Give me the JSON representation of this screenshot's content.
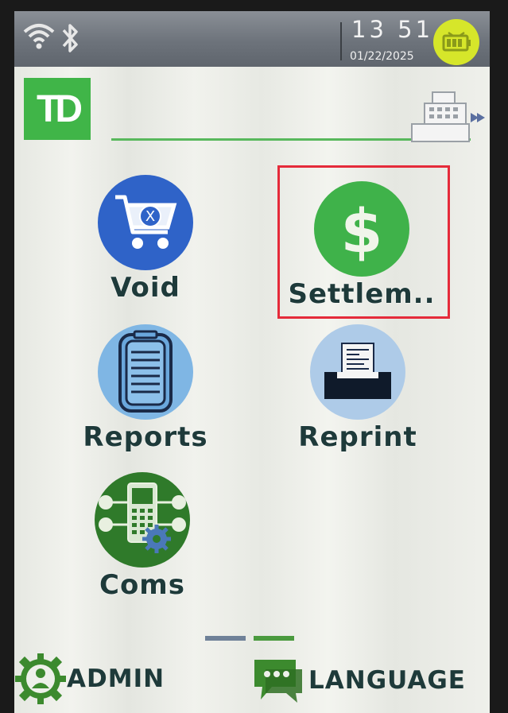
{
  "status_bar": {
    "time": "13 51",
    "date": "01/22/2025",
    "icons": [
      "wifi-icon",
      "bluetooth-icon",
      "battery-icon"
    ]
  },
  "brand": {
    "logo_text": "TD",
    "color": "#40b548"
  },
  "menu": {
    "items": [
      {
        "label": "Void",
        "icon": "cart-void-icon",
        "color": "#2f63c8"
      },
      {
        "label": "Settlem..",
        "icon": "dollar-icon",
        "color": "#3fb24a"
      },
      {
        "label": "Reports",
        "icon": "clipboard-icon",
        "color": "#7fb6e4"
      },
      {
        "label": "Reprint",
        "icon": "printer-icon",
        "color": "#aecbe8"
      },
      {
        "label": "Coms",
        "icon": "terminal-network-icon",
        "color": "#2f7a2a"
      }
    ]
  },
  "pagination": {
    "current": 2,
    "total": 2
  },
  "footer": {
    "admin_label": "ADMIN",
    "language_label": "LANGUAGE"
  },
  "colors": {
    "label_text": "#1e3a3a",
    "highlight_border": "#e52b3a",
    "status_bar": "#6d737b"
  }
}
